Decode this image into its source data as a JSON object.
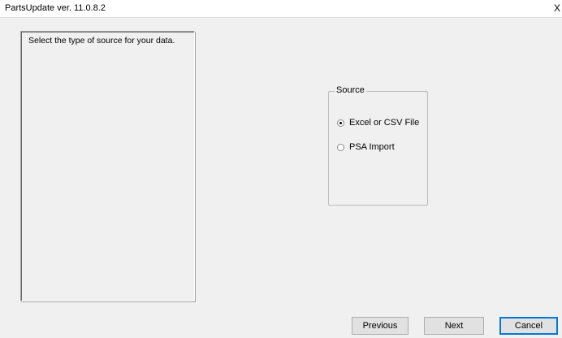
{
  "window": {
    "title": "PartsUpdate ver. 11.0.8.2",
    "close_glyph": "X"
  },
  "left_panel": {
    "instruction": "Select the type of source for your data."
  },
  "source_group": {
    "legend": "Source",
    "options": [
      {
        "label": "Excel or CSV File",
        "checked": true
      },
      {
        "label": "PSA Import",
        "checked": false
      }
    ]
  },
  "buttons": {
    "previous": "Previous",
    "next": "Next",
    "cancel": "Cancel"
  }
}
